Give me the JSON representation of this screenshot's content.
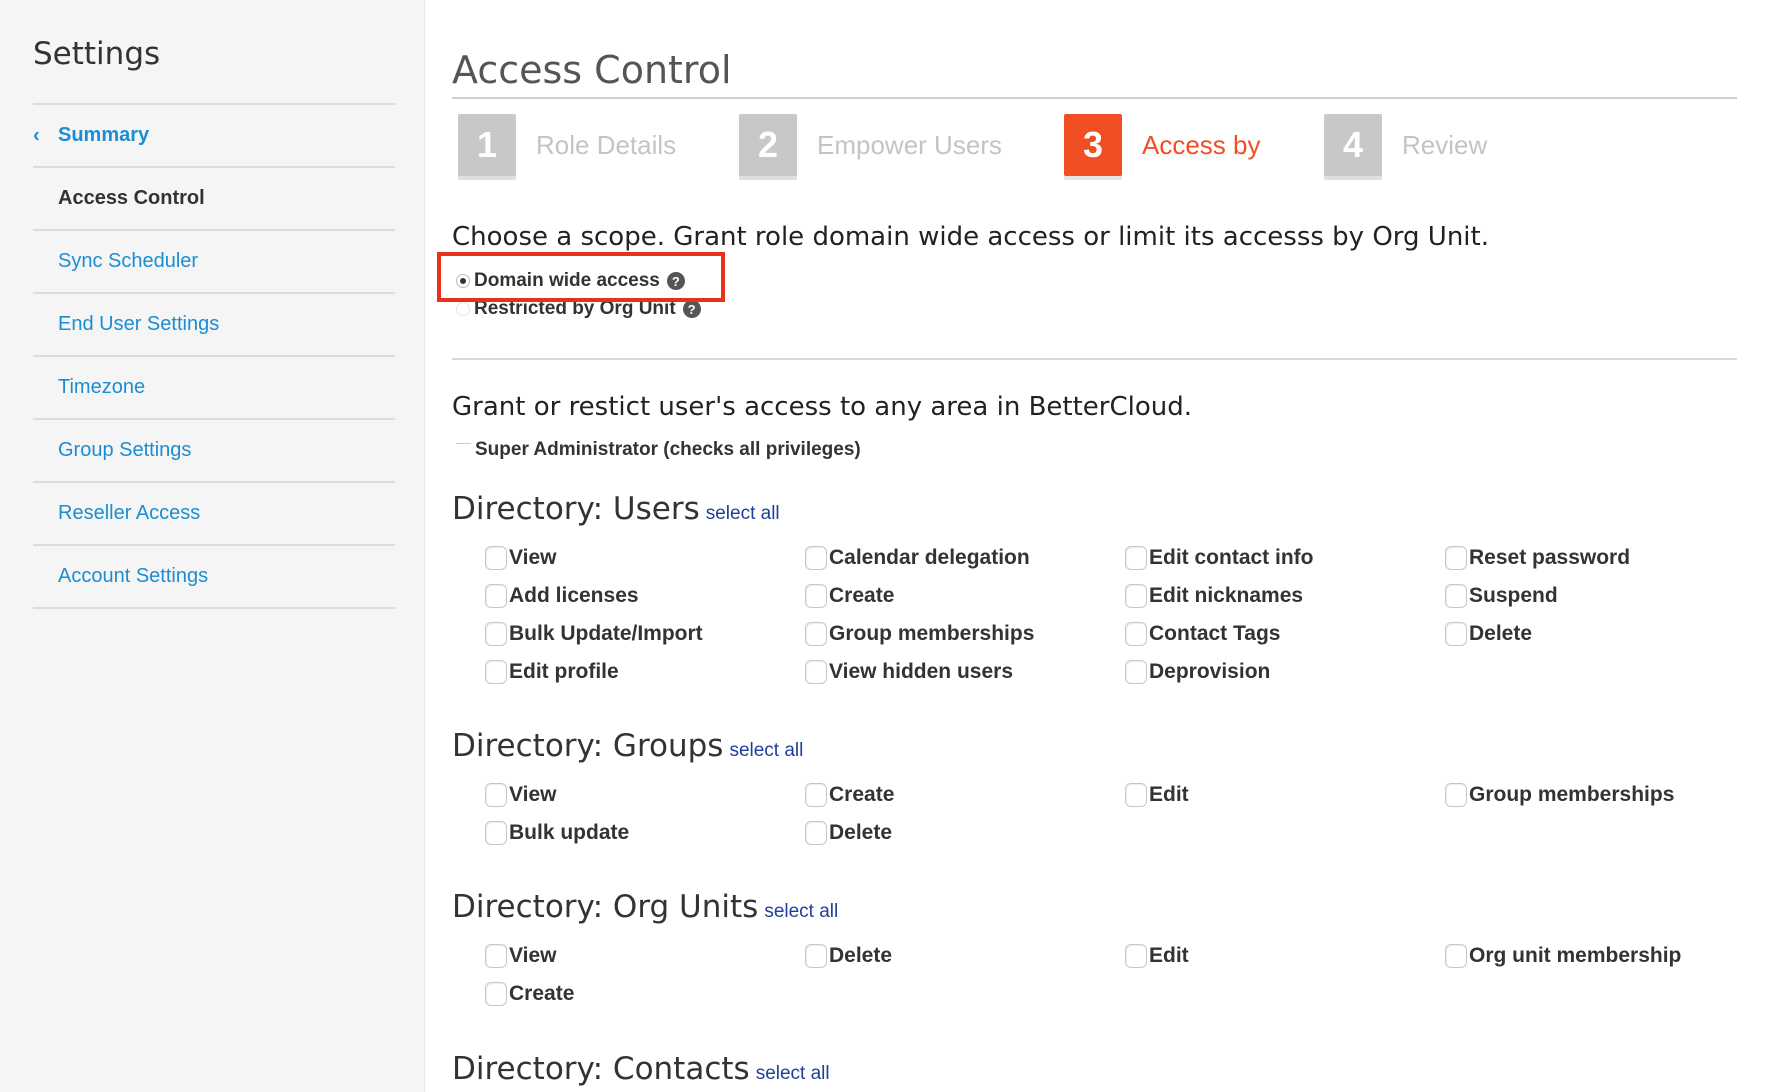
{
  "sidebar": {
    "title": "Settings",
    "back_label": "Summary",
    "items": [
      {
        "label": "Access Control",
        "active": true
      },
      {
        "label": "Sync Scheduler"
      },
      {
        "label": "End User Settings"
      },
      {
        "label": "Timezone"
      },
      {
        "label": "Group Settings"
      },
      {
        "label": "Reseller Access"
      },
      {
        "label": "Account Settings"
      }
    ]
  },
  "main": {
    "title": "Access Control",
    "steps": [
      {
        "num": "1",
        "label": "Role Details"
      },
      {
        "num": "2",
        "label": "Empower Users"
      },
      {
        "num": "3",
        "label": "Access by"
      },
      {
        "num": "4",
        "label": "Review"
      }
    ],
    "current_step": 3,
    "scope": {
      "heading": "Choose a scope. Grant role domain wide access or limit its accesss by Org Unit.",
      "options": [
        {
          "label": "Domain wide access",
          "checked": true
        },
        {
          "label": "Restricted by Org Unit",
          "checked": false
        }
      ],
      "help_glyph": "?"
    },
    "grant_heading": "Grant or restict user's access to any area in BetterCloud.",
    "super_admin_label": "Super Administrator (checks all privileges)",
    "select_all_label": "select all",
    "sections": [
      {
        "title": "Directory: Users",
        "columns": [
          [
            "View",
            "Add licenses",
            "Bulk Update/Import",
            "Edit profile"
          ],
          [
            "Calendar delegation",
            "Create",
            "Group memberships",
            "View hidden users"
          ],
          [
            "Edit contact info",
            "Edit nicknames",
            "Contact Tags",
            "Deprovision"
          ],
          [
            "Reset password",
            "Suspend",
            "Delete"
          ]
        ]
      },
      {
        "title": "Directory: Groups",
        "columns": [
          [
            "View",
            "Bulk update"
          ],
          [
            "Create",
            "Delete"
          ],
          [
            "Edit"
          ],
          [
            "Group memberships"
          ]
        ]
      },
      {
        "title": "Directory: Org Units",
        "columns": [
          [
            "View",
            "Create"
          ],
          [
            "Delete"
          ],
          [
            "Edit"
          ],
          [
            "Org unit membership"
          ]
        ]
      },
      {
        "title": "Directory: Contacts",
        "columns": []
      }
    ]
  },
  "colors": {
    "accent": "#f04e23",
    "link": "#1a8ed1",
    "select_all": "#1f3f9a",
    "highlight": "#e8311a",
    "step_inactive": "#c8c8c8"
  }
}
